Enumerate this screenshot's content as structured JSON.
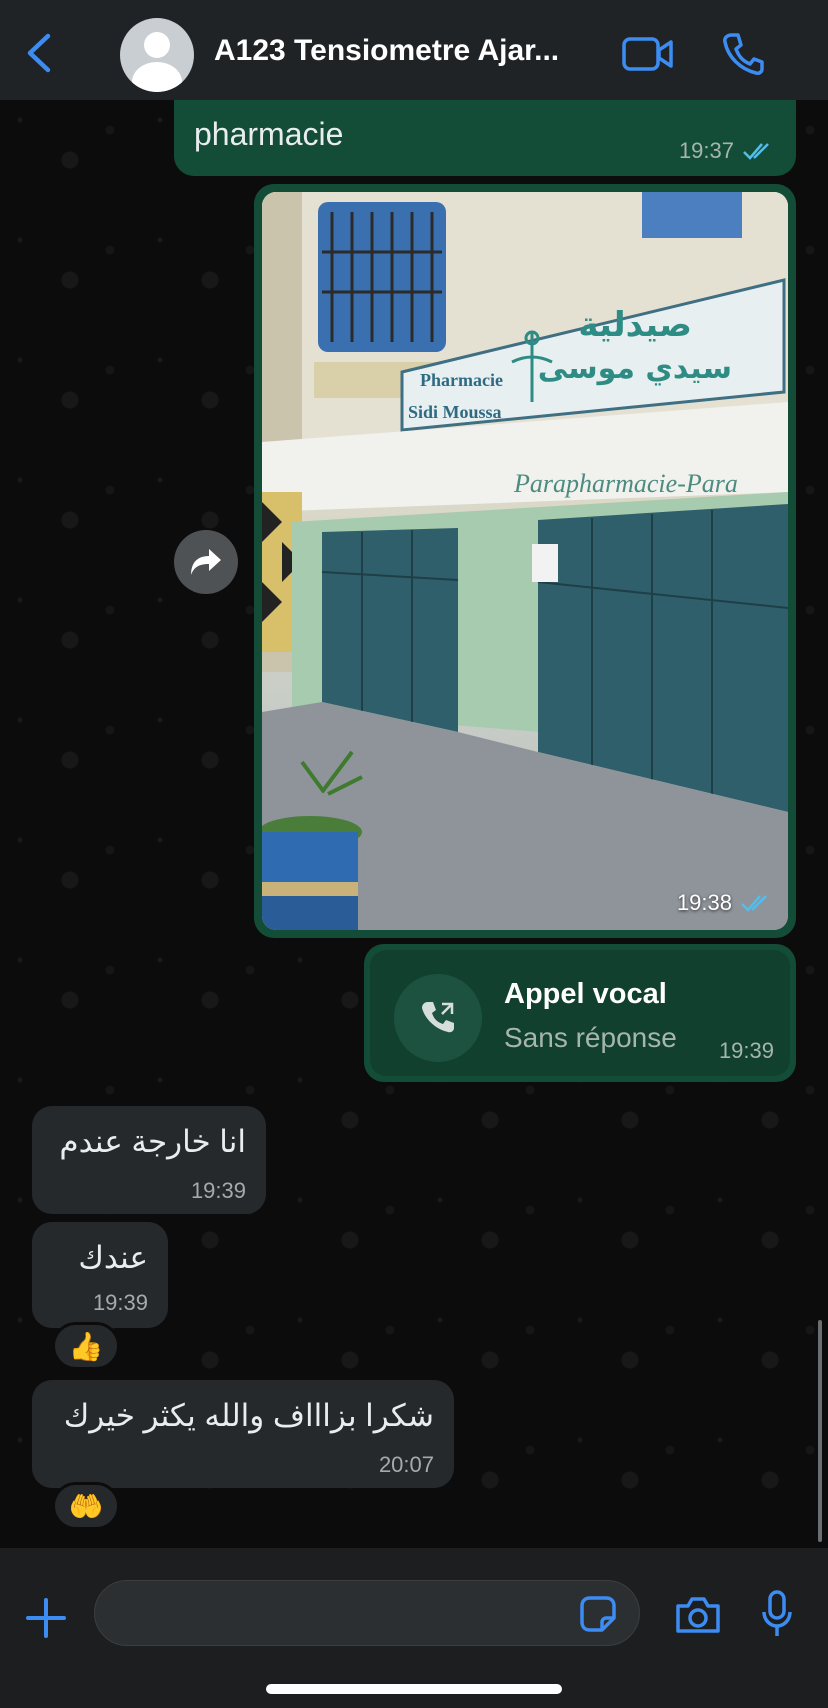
{
  "header": {
    "title": "A123 Tensiometre Ajar...",
    "back_icon": "chevron-left-icon",
    "video_icon": "video-camera-icon",
    "call_icon": "phone-icon",
    "accent": "#3d8cf2"
  },
  "messages": {
    "pharmacie": {
      "text": "pharmacie",
      "time": "19:37"
    },
    "photo": {
      "time": "19:38",
      "sign_fr": "Pharmacie",
      "sign_fr2": "Sidi Moussa",
      "sign_ar": "صيدلية",
      "sign_ar2": "سيدي موسى",
      "wall_text": "Parapharmacie-Para"
    },
    "call": {
      "title": "Appel vocal",
      "subtitle": "Sans réponse",
      "time": "19:39"
    },
    "in1": {
      "text": "انا خارجة عندم",
      "time": "19:39"
    },
    "in2": {
      "text": "عندك",
      "time": "19:39",
      "reaction": "👍"
    },
    "in3": {
      "text": "شكرا بزاااف والله يكثر خيرك",
      "time": "20:07",
      "reaction": "🤲"
    }
  },
  "colors": {
    "outgoing_bubble": "#144d37",
    "incoming_bubble": "#26292b",
    "read_ticks": "#53bdeb"
  }
}
